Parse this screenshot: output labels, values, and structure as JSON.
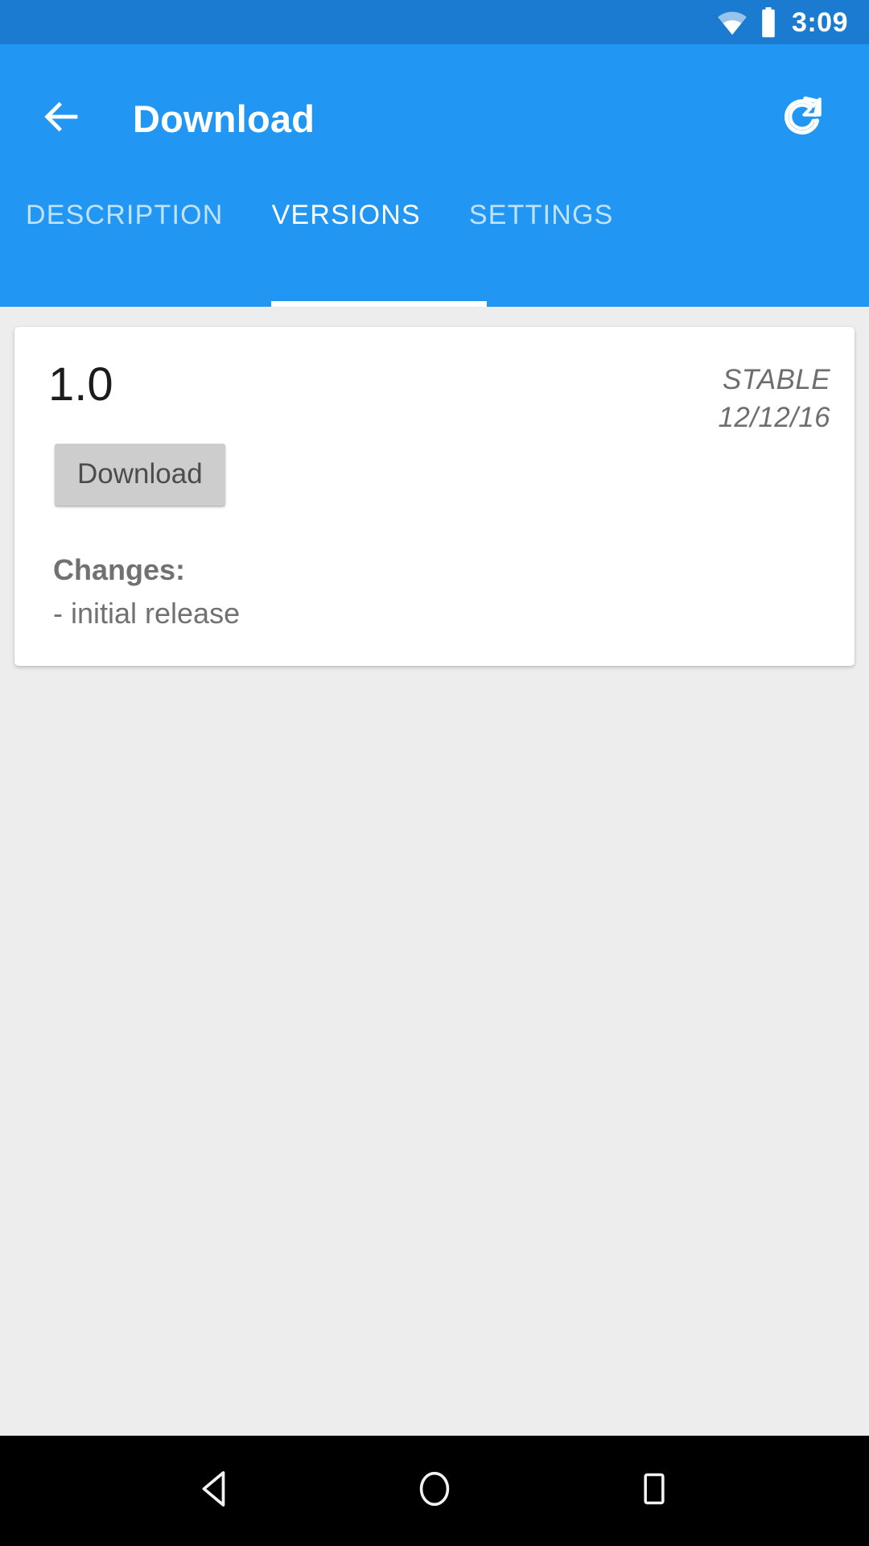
{
  "status_bar": {
    "time": "3:09",
    "wifi_icon": "wifi-icon",
    "battery_icon": "battery-full-icon",
    "background_color": "#1b7bd0"
  },
  "app_bar": {
    "title": "Download",
    "back_icon": "back-arrow-icon",
    "refresh_icon": "refresh-icon",
    "background_color": "#2196f3",
    "tabs": [
      {
        "label": "DESCRIPTION",
        "active": false
      },
      {
        "label": "VERSIONS",
        "active": true
      },
      {
        "label": "SETTINGS",
        "active": false
      }
    ],
    "active_tab": "VERSIONS",
    "indicator_color": "#ffffff"
  },
  "content": {
    "background_color": "#ededed",
    "version_card": {
      "version": "1.0",
      "channel": "STABLE",
      "date": "12/12/16",
      "download_label": "Download",
      "changes_title": "Changes:",
      "changes": [
        "- initial release"
      ],
      "card_color": "#ffffff",
      "button_color": "#cdcdcd",
      "meta_text_color": "#6e6e6e",
      "changes_text_color": "#717171"
    }
  },
  "nav_bar": {
    "background_color": "#000000",
    "buttons": [
      {
        "name": "back-nav-icon"
      },
      {
        "name": "home-nav-icon"
      },
      {
        "name": "recents-nav-icon"
      }
    ]
  }
}
